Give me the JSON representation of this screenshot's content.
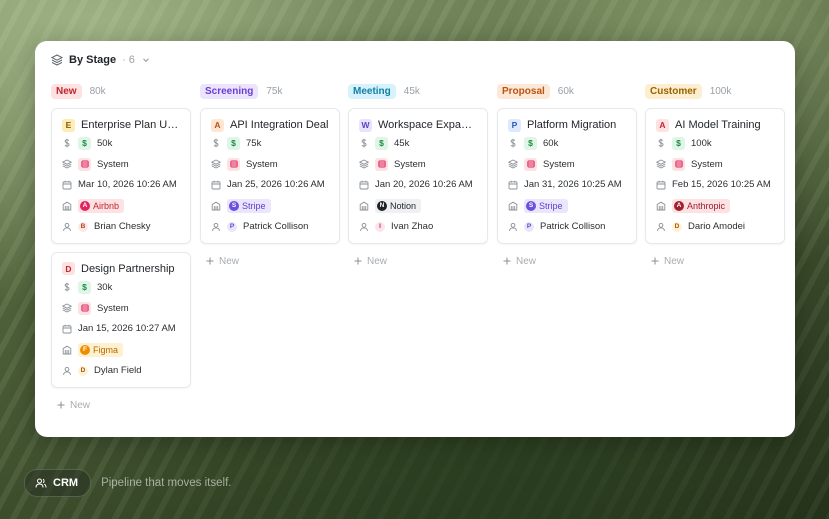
{
  "header": {
    "title": "By Stage",
    "count": "· 6"
  },
  "colors": {
    "card_border": "#e6e8eb",
    "money_green": "#1a8c44"
  },
  "columns": [
    {
      "stage": "New",
      "total": "80k",
      "stage_bg": "#fde2e1",
      "stage_fg": "#c0262d",
      "add_label": "New",
      "cards": [
        {
          "letter": "E",
          "letter_bg": "#fdecb5",
          "letter_fg": "#8a5a00",
          "title": "Enterprise Plan Up…",
          "amount": "50k",
          "source": "System",
          "date": "Mar 10, 2026 10:26 AM",
          "company": {
            "name": "Airbnb",
            "initial": "A",
            "bg": "#fde2e4",
            "fg": "#c0262d",
            "dot": "#e0245e"
          },
          "contact": {
            "name": "Brian Chesky",
            "initial": "B",
            "bg": "#fde8e0",
            "fg": "#b4412a"
          }
        },
        {
          "letter": "D",
          "letter_bg": "#fde2e1",
          "letter_fg": "#c0262d",
          "title": "Design Partnership",
          "amount": "30k",
          "source": "System",
          "date": "Jan 15, 2026 10:27 AM",
          "company": {
            "name": "Figma",
            "initial": "F",
            "bg": "#fff0cf",
            "fg": "#b36b00",
            "dot": "#f08c00"
          },
          "contact": {
            "name": "Dylan Field",
            "initial": "D",
            "bg": "#fff0d6",
            "fg": "#a05a00"
          }
        }
      ]
    },
    {
      "stage": "Screening",
      "total": "75k",
      "stage_bg": "#ece4fd",
      "stage_fg": "#6b3fd4",
      "add_label": "New",
      "cards": [
        {
          "letter": "A",
          "letter_bg": "#fde7d3",
          "letter_fg": "#b4531a",
          "title": "API Integration Deal",
          "amount": "75k",
          "source": "System",
          "date": "Jan 25, 2026 10:26 AM",
          "company": {
            "name": "Stripe",
            "initial": "S",
            "bg": "#ece6fd",
            "fg": "#5b3fd0",
            "dot": "#6b4fe0"
          },
          "contact": {
            "name": "Patrick Collison",
            "initial": "P",
            "bg": "#e9e6fb",
            "fg": "#5b46c8"
          }
        }
      ]
    },
    {
      "stage": "Meeting",
      "total": "45k",
      "stage_bg": "#d7f2fb",
      "stage_fg": "#1380a8",
      "add_label": "New",
      "cards": [
        {
          "letter": "W",
          "letter_bg": "#e9e4fb",
          "letter_fg": "#5c43c4",
          "title": "Workspace Expan…",
          "amount": "45k",
          "source": "System",
          "date": "Jan 20, 2026 10:26 AM",
          "company": {
            "name": "Notion",
            "initial": "N",
            "bg": "#eef0f2",
            "fg": "#1f2328",
            "dot": "#1f2328"
          },
          "contact": {
            "name": "Ivan Zhao",
            "initial": "I",
            "bg": "#fde4ea",
            "fg": "#b3314f"
          }
        }
      ]
    },
    {
      "stage": "Proposal",
      "total": "60k",
      "stage_bg": "#fde8d8",
      "stage_fg": "#b95413",
      "add_label": "New",
      "cards": [
        {
          "letter": "P",
          "letter_bg": "#dde9fc",
          "letter_fg": "#2a5bb8",
          "title": "Platform Migration",
          "amount": "60k",
          "source": "System",
          "date": "Jan 31, 2026 10:25 AM",
          "company": {
            "name": "Stripe",
            "initial": "S",
            "bg": "#ece6fd",
            "fg": "#5b3fd0",
            "dot": "#6b4fe0"
          },
          "contact": {
            "name": "Patrick Collison",
            "initial": "P",
            "bg": "#e9e6fb",
            "fg": "#5b46c8"
          }
        }
      ]
    },
    {
      "stage": "Customer",
      "total": "100k",
      "stage_bg": "#fdeed0",
      "stage_fg": "#9a6200",
      "add_label": "New",
      "cards": [
        {
          "letter": "A",
          "letter_bg": "#fde2e1",
          "letter_fg": "#c0262d",
          "title": "AI Model Training",
          "amount": "100k",
          "source": "System",
          "date": "Feb 15, 2026 10:25 AM",
          "company": {
            "name": "Anthropic",
            "initial": "A",
            "bg": "#fde2e4",
            "fg": "#9b1c2c",
            "dot": "#a3202f"
          },
          "contact": {
            "name": "Dario Amodei",
            "initial": "D",
            "bg": "#fff0d6",
            "fg": "#a05a00"
          }
        }
      ]
    }
  ],
  "footer": {
    "crm_label": "CRM",
    "tagline": "Pipeline that moves itself."
  }
}
